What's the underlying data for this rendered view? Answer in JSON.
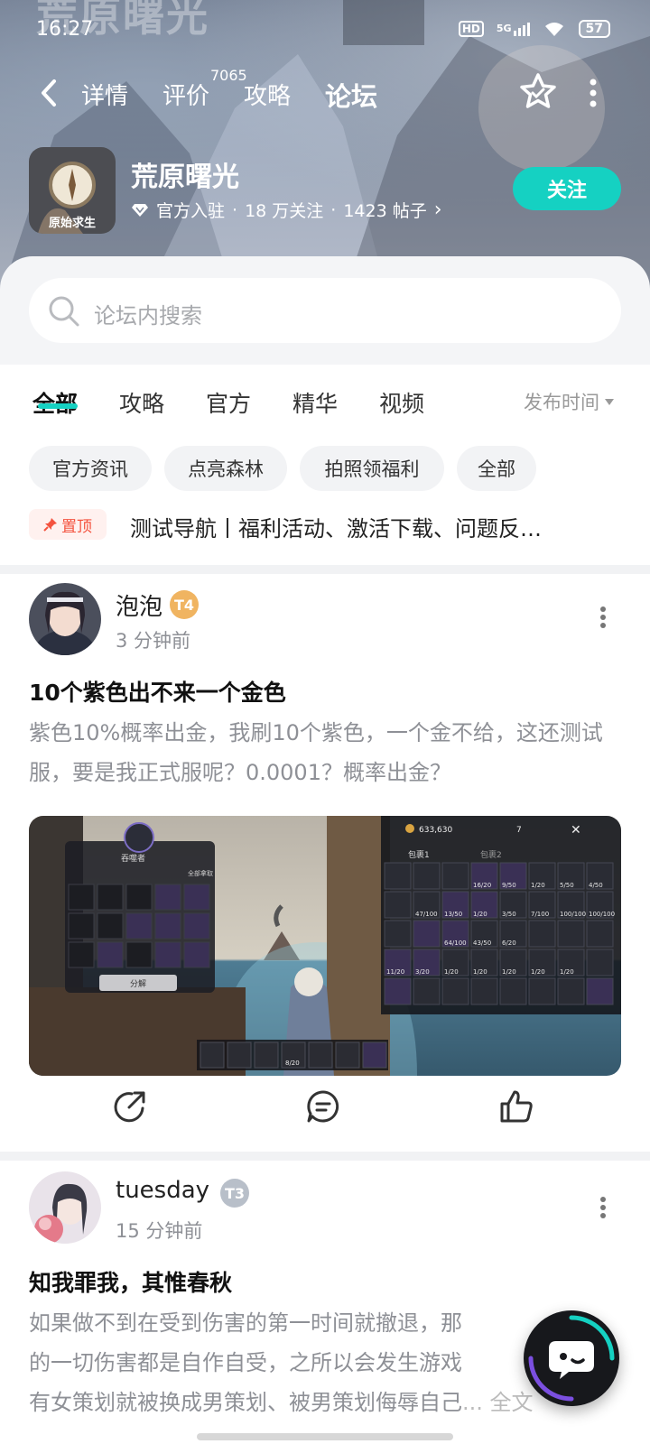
{
  "status_bar": {
    "time": "16:27",
    "hd": "HD",
    "network": "5G",
    "battery": "57"
  },
  "banner": {
    "watermark": "荒原曙光"
  },
  "nav": {
    "tabs": [
      {
        "label": "详情"
      },
      {
        "label": "评价"
      },
      {
        "label": "攻略"
      },
      {
        "label": "论坛"
      }
    ],
    "review_count": "7065",
    "active_tab": "论坛"
  },
  "game": {
    "title": "荒原曙光",
    "icon_label": "原始求生",
    "stats": {
      "official": "官方入驻",
      "sep1": "·",
      "followers": "18 万关注",
      "sep2": "·",
      "posts": "1423 帖子",
      "chevron": "›"
    },
    "follow_label": "关注"
  },
  "search": {
    "placeholder": "论坛内搜索"
  },
  "filters": {
    "tabs": [
      {
        "label": "全部"
      },
      {
        "label": "攻略"
      },
      {
        "label": "官方"
      },
      {
        "label": "精华"
      },
      {
        "label": "视频"
      }
    ],
    "sort_label": "发布时间",
    "chips": [
      {
        "label": "官方资讯"
      },
      {
        "label": "点亮森林"
      },
      {
        "label": "拍照领福利"
      },
      {
        "label": "全部"
      }
    ]
  },
  "pinned": {
    "badge": "置顶",
    "text": "测试导航丨福利活动、激活下载、问题反…"
  },
  "posts": [
    {
      "username": "泡泡",
      "level": "T4",
      "level_color": "#f0b461",
      "time": "3 分钟前",
      "title": "10个紫色出不来一个金色",
      "body": "紫色10%概率出金，我刷10个紫色，一个金不给，这还测试服，要是我正式服呢？0.0001？概率出金？",
      "image": {
        "currency": "633,630",
        "count": "7",
        "panel_title": "吞噬者",
        "panel_tab": "全部拿取",
        "decompose_button": "分解",
        "bag_tab1": "包裹1",
        "bag_tab2": "包裹2",
        "bag_counts": [
          "16/20",
          "9/50",
          "1/20",
          "5/50",
          "4/50",
          "47/100",
          "13/50",
          "1/20",
          "3/50",
          "7/100",
          "100/100",
          "100/100",
          "64/100",
          "43/50",
          "6/20",
          "11/20",
          "3/20",
          "1/20",
          "1/20",
          "1/20",
          "1/20",
          "1/20"
        ],
        "hotbar_count": "8/20"
      }
    },
    {
      "username": "tuesday",
      "level": "T3",
      "level_color": "#b8bfc9",
      "time": "15 分钟前",
      "title": "知我罪我，其惟春秋",
      "body_lines": [
        "如果做不到在受到伤害的第一时间就撤退，那",
        "的一切伤害都是自作自受，之所以会发生游戏",
        "有女策划就被换成男策划、被男策划侮辱自己"
      ],
      "more_label": "... 全文"
    }
  ],
  "icons": {
    "back": "back-arrow-icon",
    "star": "favorite-star-icon",
    "more": "more-vertical-icon",
    "search": "search-icon",
    "share": "share-icon",
    "comment": "comment-icon",
    "like": "like-icon",
    "fab": "chat-fab-icon"
  },
  "colors": {
    "accent": "#15d1c2",
    "pinned": "#f4533f",
    "muted": "#8e9096"
  }
}
